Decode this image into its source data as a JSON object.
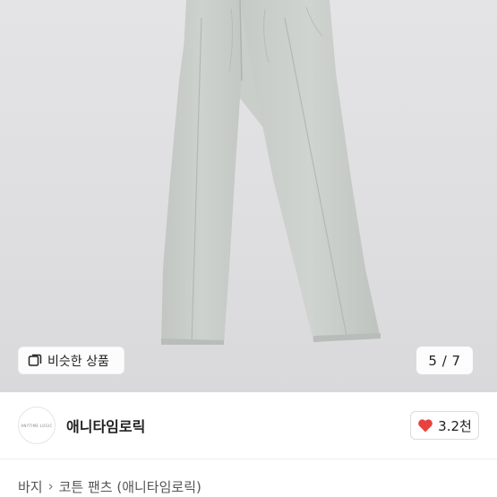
{
  "gallery": {
    "similar_label": "비슷한 상품",
    "page_indicator": "5 / 7",
    "current_index": 5,
    "total_images": 7
  },
  "seller": {
    "name": "애니타임로릭",
    "avatar_text": "ANYTIME LOGIC"
  },
  "like": {
    "count_label": "3.2천",
    "heart_color": "#e8423f"
  },
  "breadcrumb": {
    "items": [
      "바지",
      "코튼 팬츠 (애니타임로릭)"
    ]
  },
  "colors": {
    "photo_bg": "#dfdfe1",
    "pants": "#c9cdc9",
    "text_primary": "#222222"
  }
}
